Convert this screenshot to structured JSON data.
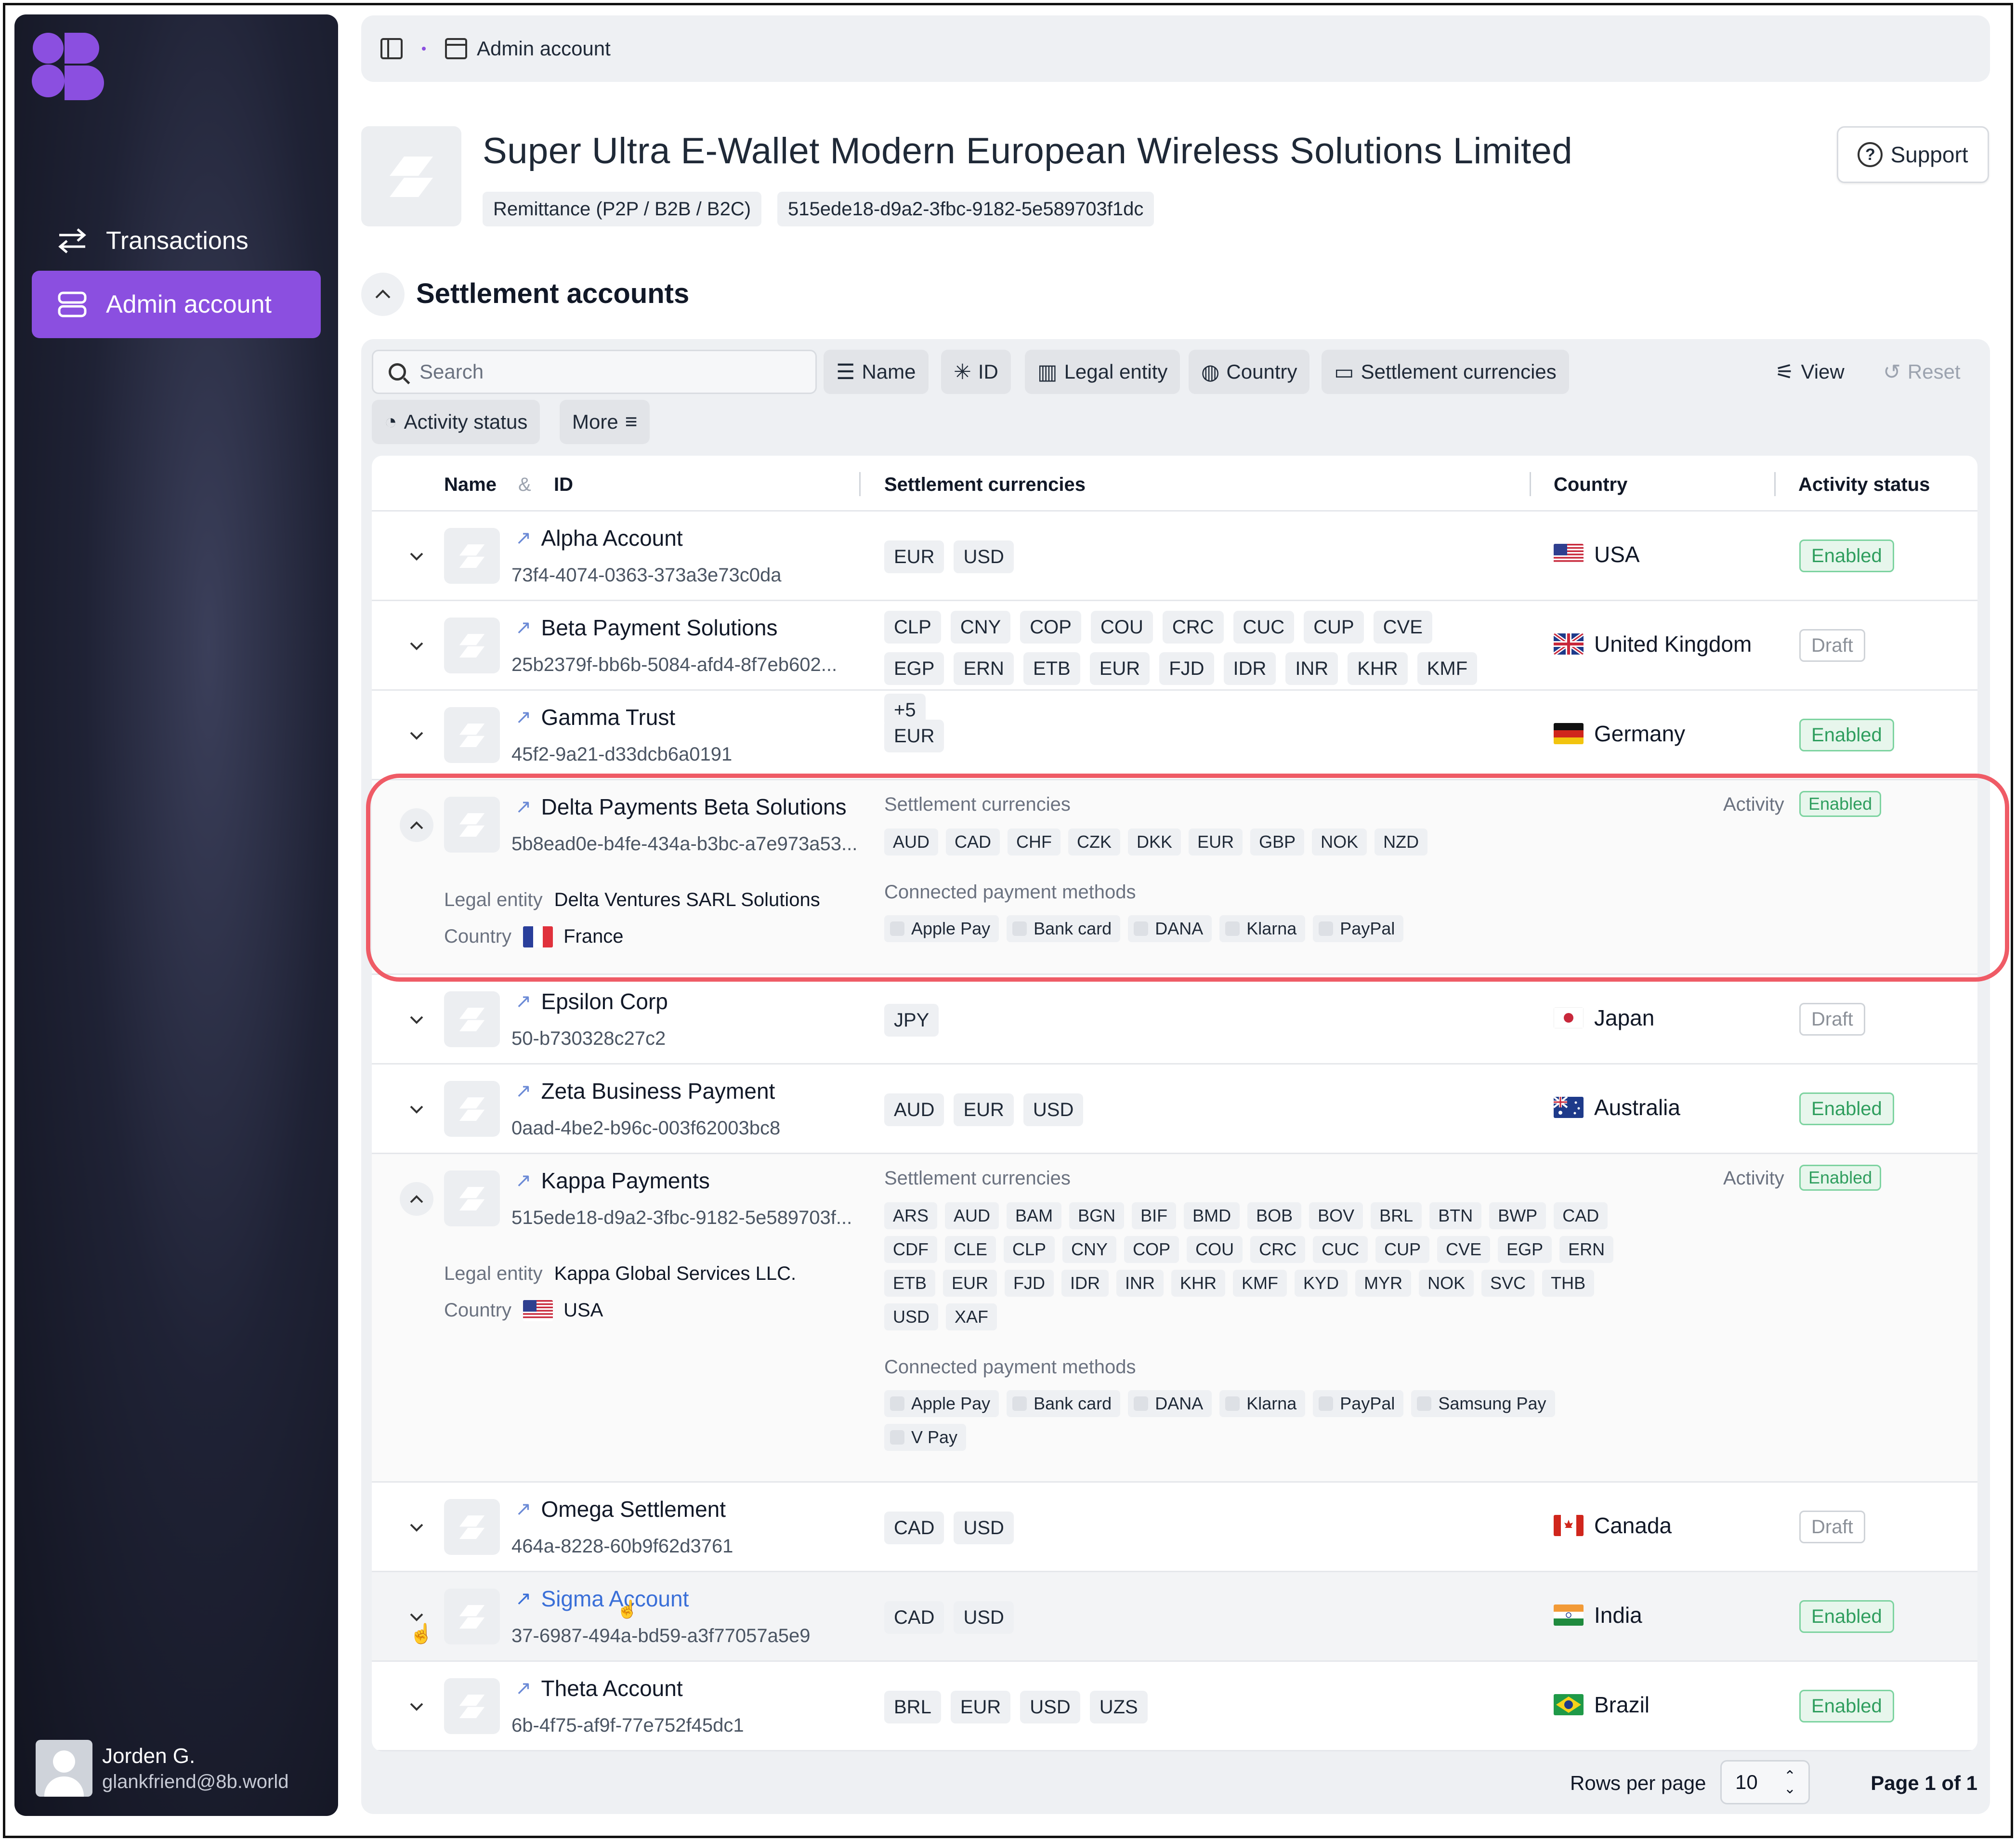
{
  "sidebar": {
    "logo": "8B",
    "nav": [
      {
        "label": "Transactions",
        "icon": "arrows-swap-icon",
        "active": false
      },
      {
        "label": "Admin account",
        "icon": "server-stack-icon",
        "active": true
      }
    ],
    "user": {
      "name": "Jorden G.",
      "email": "glankfriend@8b.world"
    }
  },
  "breadcrumb": {
    "current": "Admin account"
  },
  "header": {
    "title": "Super Ultra E-Wallet Modern European Wireless Solutions Limited",
    "type_tag": "Remittance (P2P / B2B / B2C)",
    "id_tag": "515ede18-d9a2-3fbc-9182-5e589703f1dc",
    "support_label": "Support"
  },
  "section": {
    "title": "Settlement accounts"
  },
  "filters": {
    "search_placeholder": "Search",
    "buttons": [
      "Name",
      "ID",
      "Legal entity",
      "Country",
      "Settlement currencies"
    ],
    "second_row": [
      "Activity status",
      "More"
    ],
    "view_label": "View",
    "reset_label": "Reset"
  },
  "table": {
    "headers": {
      "name": "Name",
      "amp": "&",
      "id": "ID",
      "currencies": "Settlement currencies",
      "country": "Country",
      "status": "Activity status"
    },
    "rows": [
      {
        "name": "Alpha Account",
        "id": "73f4-4074-0363-373a3e73c0da",
        "currencies": [
          "EUR",
          "USD"
        ],
        "country": "USA",
        "status": "Enabled"
      },
      {
        "name": "Beta Payment Solutions",
        "id": "25b2379f-bb6b-5084-afd4-8f7eb602...",
        "currencies": [
          "CLP",
          "CNY",
          "COP",
          "COU",
          "CRC",
          "CUC",
          "CUP",
          "CVE",
          "EGP",
          "ERN",
          "ETB",
          "EUR",
          "FJD",
          "IDR",
          "INR",
          "KHR",
          "KMF",
          "+5"
        ],
        "country": "United Kingdom",
        "status": "Draft"
      },
      {
        "name": "Gamma Trust",
        "id": "45f2-9a21-d33dcb6a0191",
        "currencies": [
          "EUR"
        ],
        "country": "Germany",
        "status": "Enabled"
      },
      {
        "name": "Delta Payments Beta Solutions",
        "id": "5b8ead0e-b4fe-434a-b3bc-a7e973a53...",
        "expanded": true,
        "legal_entity_label": "Legal entity",
        "legal_entity": "Delta Ventures SARL Solutions",
        "country_label": "Country",
        "country": "France",
        "settlement_label": "Settlement currencies",
        "currencies": [
          "AUD",
          "CAD",
          "CHF",
          "CZK",
          "DKK",
          "EUR",
          "GBP",
          "NOK",
          "NZD"
        ],
        "methods_label": "Connected payment methods",
        "methods": [
          "Apple Pay",
          "Bank card",
          "DANA",
          "Klarna",
          "PayPal"
        ],
        "activity_label": "Activity",
        "status": "Enabled"
      },
      {
        "name": "Epsilon Corp",
        "id": "50-b730328c27c2",
        "currencies": [
          "JPY"
        ],
        "country": "Japan",
        "status": "Draft"
      },
      {
        "name": "Zeta Business Payment",
        "id": "0aad-4be2-b96c-003f62003bc8",
        "currencies": [
          "AUD",
          "EUR",
          "USD"
        ],
        "country": "Australia",
        "status": "Enabled"
      },
      {
        "name": "Kappa Payments",
        "id": "515ede18-d9a2-3fbc-9182-5e589703f...",
        "expanded": true,
        "legal_entity_label": "Legal entity",
        "legal_entity": "Kappa Global Services LLC.",
        "country_label": "Country",
        "country": "USA",
        "settlement_label": "Settlement currencies",
        "currencies": [
          "ARS",
          "AUD",
          "BAM",
          "BGN",
          "BIF",
          "BMD",
          "BOB",
          "BOV",
          "BRL",
          "BTN",
          "BWP",
          "CAD",
          "CDF",
          "CLE",
          "CLP",
          "CNY",
          "COP",
          "COU",
          "CRC",
          "CUC",
          "CUP",
          "CVE",
          "EGP",
          "ERN",
          "ETB",
          "EUR",
          "FJD",
          "IDR",
          "INR",
          "KHR",
          "KMF",
          "KYD",
          "MYR",
          "NOK",
          "SVC",
          "THB",
          "USD",
          "XAF"
        ],
        "methods_label": "Connected payment methods",
        "methods": [
          "Apple Pay",
          "Bank card",
          "DANA",
          "Klarna",
          "PayPal",
          "Samsung Pay",
          "V Pay"
        ],
        "activity_label": "Activity",
        "status": "Enabled"
      },
      {
        "name": "Omega Settlement",
        "id": "464a-8228-60b9f62d3761",
        "currencies": [
          "CAD",
          "USD"
        ],
        "country": "Canada",
        "status": "Draft"
      },
      {
        "name": "Sigma Account",
        "id": "37-6987-494a-bd59-a3f77057a5e9",
        "currencies": [
          "CAD",
          "USD"
        ],
        "country": "India",
        "status": "Enabled",
        "hovered": true
      },
      {
        "name": "Theta Account",
        "id": "6b-4f75-af9f-77e752f45dc1",
        "currencies": [
          "BRL",
          "EUR",
          "USD",
          "UZS"
        ],
        "country": "Brazil",
        "status": "Enabled"
      }
    ]
  },
  "footer": {
    "rows_per_page_label": "Rows per page",
    "rows_per_page": "10",
    "page_info": "Page 1 of 1"
  },
  "colors": {
    "accent": "#8b4fe0",
    "enabled": "#2f9e5e",
    "highlight": "#ef5b66",
    "link": "#3a6fd8"
  }
}
